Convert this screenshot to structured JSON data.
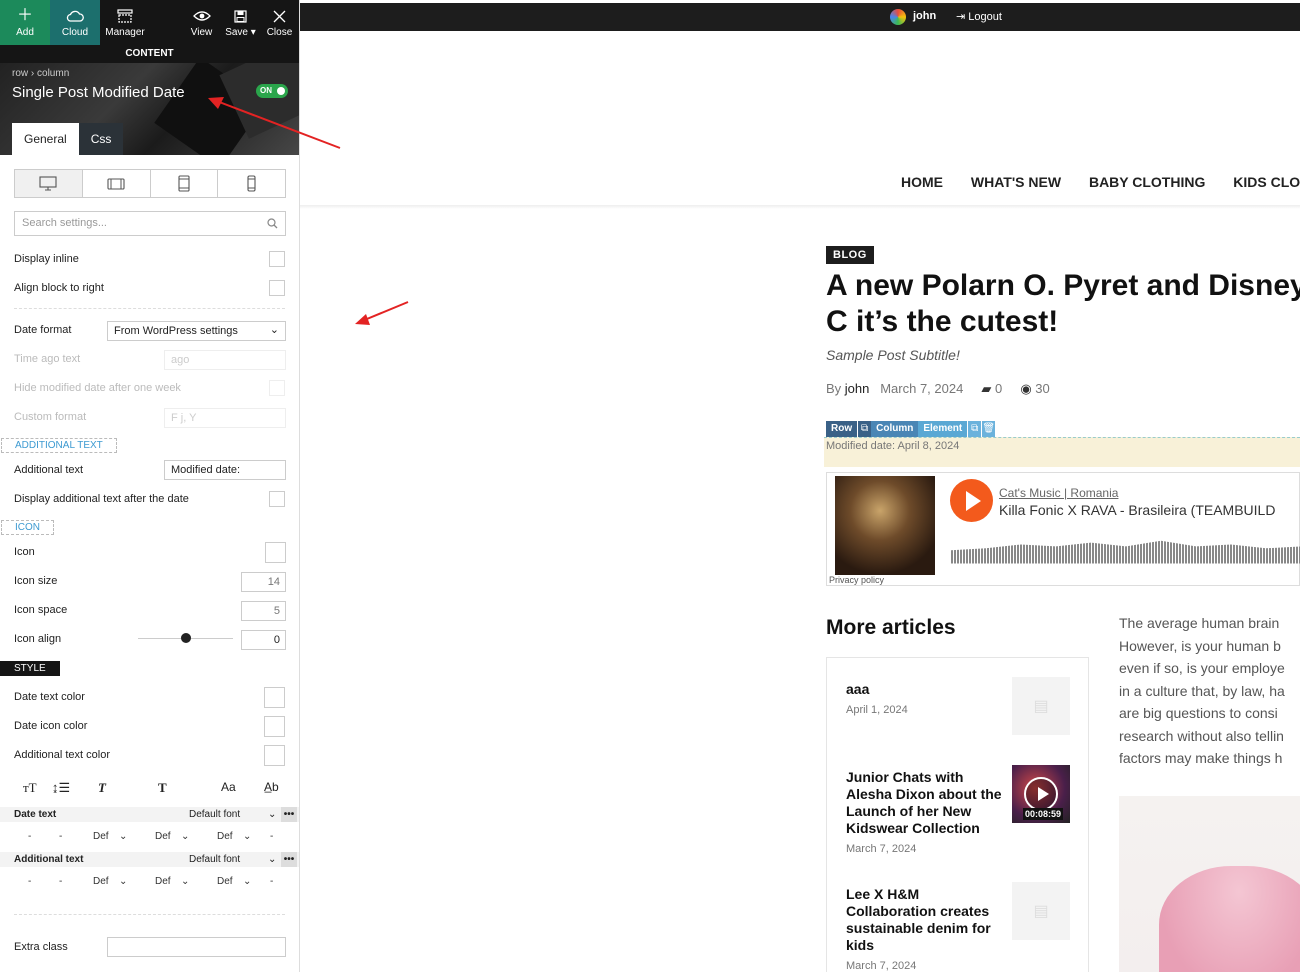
{
  "toolbar": {
    "add_label": "Add",
    "cloud_label": "Cloud",
    "manager_label": "Manager",
    "view_label": "View",
    "save_label": "Save",
    "close_label": "Close"
  },
  "panel": {
    "content_label": "CONTENT",
    "breadcrumb_row": "row",
    "breadcrumb_column": "column",
    "title": "Single Post Modified Date",
    "toggle_label": "ON",
    "tabs": [
      "General",
      "Css"
    ],
    "search_placeholder": "Search settings...",
    "display_inline": "Display inline",
    "align_right": "Align block to right",
    "date_format_label": "Date format",
    "date_format_value": "From WordPress settings",
    "time_ago_label": "Time ago text",
    "time_ago_value": "ago",
    "hide_modified": "Hide modified date after one week",
    "custom_format_label": "Custom format",
    "custom_format_value": "F j, Y",
    "additional_text_section": "ADDITIONAL TEXT",
    "additional_text_label": "Additional text",
    "additional_text_value": "Modified date:",
    "display_after": "Display additional text after the date",
    "icon_section": "ICON",
    "icon_label": "Icon",
    "icon_size_label": "Icon size",
    "icon_size_value": "14",
    "icon_space_label": "Icon space",
    "icon_space_value": "5",
    "icon_align_label": "Icon align",
    "icon_align_value": "0",
    "style_section": "STYLE",
    "date_text_color": "Date text color",
    "date_icon_color": "Date icon color",
    "additional_text_color": "Additional text color",
    "typo_date_text": "Date text",
    "typo_additional_text": "Additional text",
    "default_font": "Default font",
    "def": "Def",
    "dash": "-",
    "extra_class_label": "Extra class",
    "typo_aa": "Aa"
  },
  "site": {
    "user": "john",
    "logout": "Logout",
    "nav": [
      "HOME",
      "WHAT'S NEW",
      "BABY CLOTHING",
      "KIDS CLOT"
    ],
    "badge": "BLOG",
    "title": "A new Polarn O. Pyret and Disney C it’s the cutest!",
    "subtitle": "Sample Post Subtitle!",
    "by": "By",
    "author": "john",
    "date": "March 7, 2024",
    "comments": "0",
    "views": "30",
    "el_row": "Row",
    "el_column": "Column",
    "el_element": "Element",
    "modified": "Modified date: April 8, 2024",
    "artist": "Cat's Music | Romania",
    "track": "Killa Fonic X RAVA - Brasileira (TEAMBUILD",
    "privacy": "Privacy policy",
    "more_articles": "More articles",
    "articles": [
      {
        "title": "aaa",
        "date": "April 1, 2024"
      },
      {
        "title": "Junior Chats with Alesha Dixon about the Launch of her New Kidswear Collection",
        "date": "March 7, 2024",
        "duration": "00:08:59"
      },
      {
        "title": "Lee X H&M Collaboration creates sustainable denim for kids",
        "date": "March 7, 2024"
      }
    ],
    "body_lines": [
      "The average human brain",
      "However, is your human b",
      "even if so, is your employe",
      "in a culture that, by law, ha",
      "are big questions to consi",
      "research without also tellin",
      "factors may make things h"
    ]
  }
}
